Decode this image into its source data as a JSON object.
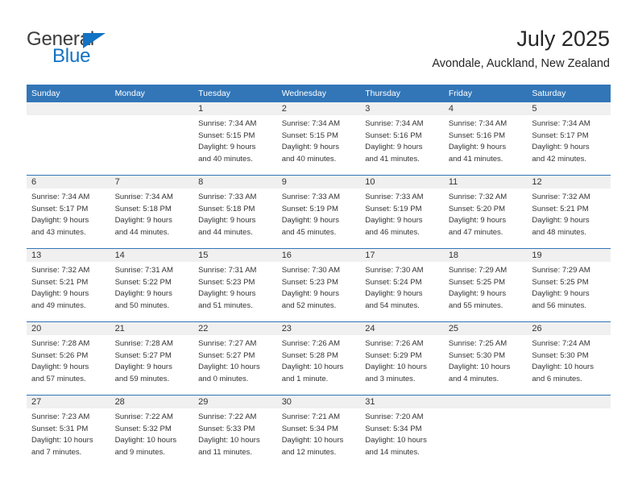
{
  "logo": {
    "word1": "General",
    "word2": "Blue",
    "triangle_color": "#1272c4",
    "word1_color": "#3b3b3b",
    "word2_color": "#1272c4"
  },
  "header": {
    "title": "July 2025",
    "subtitle": "Avondale, Auckland, New Zealand",
    "accent_color": "#3276b8",
    "band_color": "#f0f0f0"
  },
  "weekday_headers": [
    "Sunday",
    "Monday",
    "Tuesday",
    "Wednesday",
    "Thursday",
    "Friday",
    "Saturday"
  ],
  "weeks": [
    [
      {
        "day": "",
        "lines": [],
        "blank": true
      },
      {
        "day": "",
        "lines": [],
        "blank": true
      },
      {
        "day": "1",
        "lines": [
          "Sunrise: 7:34 AM",
          "Sunset: 5:15 PM",
          "Daylight: 9 hours",
          "and 40 minutes."
        ]
      },
      {
        "day": "2",
        "lines": [
          "Sunrise: 7:34 AM",
          "Sunset: 5:15 PM",
          "Daylight: 9 hours",
          "and 40 minutes."
        ]
      },
      {
        "day": "3",
        "lines": [
          "Sunrise: 7:34 AM",
          "Sunset: 5:16 PM",
          "Daylight: 9 hours",
          "and 41 minutes."
        ]
      },
      {
        "day": "4",
        "lines": [
          "Sunrise: 7:34 AM",
          "Sunset: 5:16 PM",
          "Daylight: 9 hours",
          "and 41 minutes."
        ]
      },
      {
        "day": "5",
        "lines": [
          "Sunrise: 7:34 AM",
          "Sunset: 5:17 PM",
          "Daylight: 9 hours",
          "and 42 minutes."
        ]
      }
    ],
    [
      {
        "day": "6",
        "lines": [
          "Sunrise: 7:34 AM",
          "Sunset: 5:17 PM",
          "Daylight: 9 hours",
          "and 43 minutes."
        ]
      },
      {
        "day": "7",
        "lines": [
          "Sunrise: 7:34 AM",
          "Sunset: 5:18 PM",
          "Daylight: 9 hours",
          "and 44 minutes."
        ]
      },
      {
        "day": "8",
        "lines": [
          "Sunrise: 7:33 AM",
          "Sunset: 5:18 PM",
          "Daylight: 9 hours",
          "and 44 minutes."
        ]
      },
      {
        "day": "9",
        "lines": [
          "Sunrise: 7:33 AM",
          "Sunset: 5:19 PM",
          "Daylight: 9 hours",
          "and 45 minutes."
        ]
      },
      {
        "day": "10",
        "lines": [
          "Sunrise: 7:33 AM",
          "Sunset: 5:19 PM",
          "Daylight: 9 hours",
          "and 46 minutes."
        ]
      },
      {
        "day": "11",
        "lines": [
          "Sunrise: 7:32 AM",
          "Sunset: 5:20 PM",
          "Daylight: 9 hours",
          "and 47 minutes."
        ]
      },
      {
        "day": "12",
        "lines": [
          "Sunrise: 7:32 AM",
          "Sunset: 5:21 PM",
          "Daylight: 9 hours",
          "and 48 minutes."
        ]
      }
    ],
    [
      {
        "day": "13",
        "lines": [
          "Sunrise: 7:32 AM",
          "Sunset: 5:21 PM",
          "Daylight: 9 hours",
          "and 49 minutes."
        ]
      },
      {
        "day": "14",
        "lines": [
          "Sunrise: 7:31 AM",
          "Sunset: 5:22 PM",
          "Daylight: 9 hours",
          "and 50 minutes."
        ]
      },
      {
        "day": "15",
        "lines": [
          "Sunrise: 7:31 AM",
          "Sunset: 5:23 PM",
          "Daylight: 9 hours",
          "and 51 minutes."
        ]
      },
      {
        "day": "16",
        "lines": [
          "Sunrise: 7:30 AM",
          "Sunset: 5:23 PM",
          "Daylight: 9 hours",
          "and 52 minutes."
        ]
      },
      {
        "day": "17",
        "lines": [
          "Sunrise: 7:30 AM",
          "Sunset: 5:24 PM",
          "Daylight: 9 hours",
          "and 54 minutes."
        ]
      },
      {
        "day": "18",
        "lines": [
          "Sunrise: 7:29 AM",
          "Sunset: 5:25 PM",
          "Daylight: 9 hours",
          "and 55 minutes."
        ]
      },
      {
        "day": "19",
        "lines": [
          "Sunrise: 7:29 AM",
          "Sunset: 5:25 PM",
          "Daylight: 9 hours",
          "and 56 minutes."
        ]
      }
    ],
    [
      {
        "day": "20",
        "lines": [
          "Sunrise: 7:28 AM",
          "Sunset: 5:26 PM",
          "Daylight: 9 hours",
          "and 57 minutes."
        ]
      },
      {
        "day": "21",
        "lines": [
          "Sunrise: 7:28 AM",
          "Sunset: 5:27 PM",
          "Daylight: 9 hours",
          "and 59 minutes."
        ]
      },
      {
        "day": "22",
        "lines": [
          "Sunrise: 7:27 AM",
          "Sunset: 5:27 PM",
          "Daylight: 10 hours",
          "and 0 minutes."
        ]
      },
      {
        "day": "23",
        "lines": [
          "Sunrise: 7:26 AM",
          "Sunset: 5:28 PM",
          "Daylight: 10 hours",
          "and 1 minute."
        ]
      },
      {
        "day": "24",
        "lines": [
          "Sunrise: 7:26 AM",
          "Sunset: 5:29 PM",
          "Daylight: 10 hours",
          "and 3 minutes."
        ]
      },
      {
        "day": "25",
        "lines": [
          "Sunrise: 7:25 AM",
          "Sunset: 5:30 PM",
          "Daylight: 10 hours",
          "and 4 minutes."
        ]
      },
      {
        "day": "26",
        "lines": [
          "Sunrise: 7:24 AM",
          "Sunset: 5:30 PM",
          "Daylight: 10 hours",
          "and 6 minutes."
        ]
      }
    ],
    [
      {
        "day": "27",
        "lines": [
          "Sunrise: 7:23 AM",
          "Sunset: 5:31 PM",
          "Daylight: 10 hours",
          "and 7 minutes."
        ]
      },
      {
        "day": "28",
        "lines": [
          "Sunrise: 7:22 AM",
          "Sunset: 5:32 PM",
          "Daylight: 10 hours",
          "and 9 minutes."
        ]
      },
      {
        "day": "29",
        "lines": [
          "Sunrise: 7:22 AM",
          "Sunset: 5:33 PM",
          "Daylight: 10 hours",
          "and 11 minutes."
        ]
      },
      {
        "day": "30",
        "lines": [
          "Sunrise: 7:21 AM",
          "Sunset: 5:34 PM",
          "Daylight: 10 hours",
          "and 12 minutes."
        ]
      },
      {
        "day": "31",
        "lines": [
          "Sunrise: 7:20 AM",
          "Sunset: 5:34 PM",
          "Daylight: 10 hours",
          "and 14 minutes."
        ]
      },
      {
        "day": "",
        "lines": [],
        "blank": true
      },
      {
        "day": "",
        "lines": [],
        "blank": true
      }
    ]
  ]
}
